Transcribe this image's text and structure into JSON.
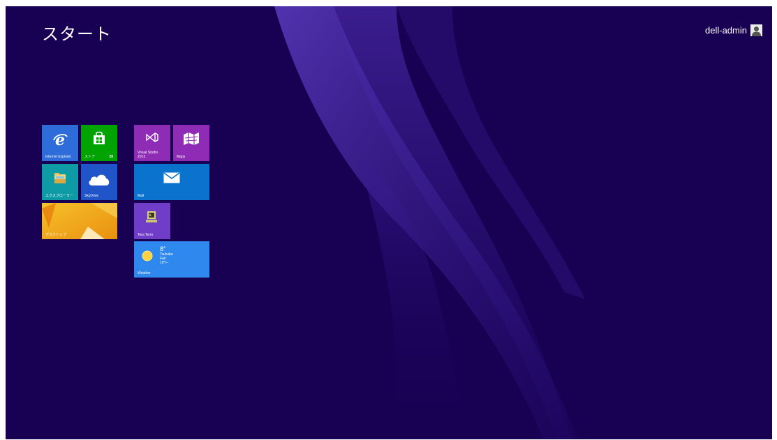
{
  "header": {
    "title": "スタート",
    "user_name": "dell-admin"
  },
  "colors": {
    "background": "#180052",
    "tile_blue": "#2e6cd9",
    "tile_green": "#00a300",
    "tile_teal": "#0e9ba5",
    "tile_dark_blue": "#1f55c8",
    "tile_magenta": "#8e2cb5",
    "tile_mail": "#0a73ce",
    "tile_purple": "#6f3dc7",
    "tile_weather": "#2f88ee"
  },
  "tiles": {
    "internet_explorer": {
      "label": "Internet Explorer",
      "icon": "internet-explorer-icon"
    },
    "store": {
      "label": "ストア",
      "badge": "20",
      "icon": "store-bag-icon"
    },
    "explorer": {
      "label": "エクスプローラー",
      "icon": "file-explorer-icon"
    },
    "skydrive": {
      "label": "SkyDrive",
      "icon": "cloud-icon"
    },
    "desktop": {
      "label": "デスクトップ"
    },
    "visual_studio": {
      "label_line1": "Visual Studio",
      "label_line2": "2013",
      "icon": "visual-studio-icon"
    },
    "maps": {
      "label": "Maps",
      "icon": "map-icon"
    },
    "mail": {
      "label": "Mail",
      "icon": "envelope-icon"
    },
    "tera_term": {
      "label": "Tera Term",
      "icon": "terminal-computer-icon"
    },
    "weather": {
      "label": "Weather",
      "temp": "8°",
      "city": "Tsukuba",
      "condition": "Fair",
      "range": "10°/--",
      "icon": "sun-icon"
    }
  }
}
